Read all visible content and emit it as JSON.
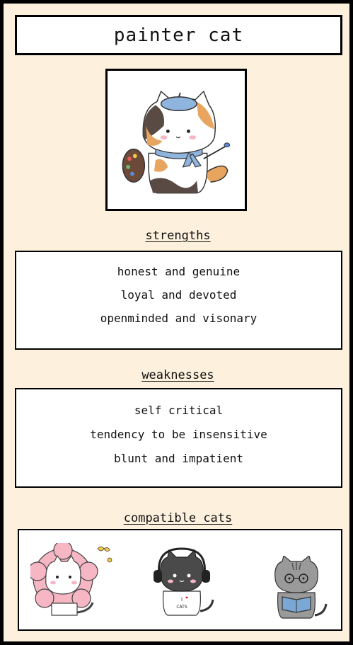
{
  "title": "painter cat",
  "strengths": {
    "heading": "strengths",
    "items": [
      "honest and genuine",
      "loyal and devoted",
      "openminded and visonary"
    ]
  },
  "weaknesses": {
    "heading": "weaknesses",
    "items": [
      "self critical",
      "tendency to be insensitive",
      "blunt and impatient"
    ]
  },
  "compatible": {
    "heading": "compatible cats",
    "cats": [
      "flower-cat",
      "headphones-cat",
      "reading-cat"
    ],
    "shirt_text_top": "I",
    "shirt_text_bottom": "CATS"
  },
  "colors": {
    "background": "#fdf1de",
    "beret": "#8fb4de",
    "scarf": "#8fb4de",
    "orange_patch": "#e8a560",
    "dark_patch": "#5a4a44",
    "flower": "#f6b6c4"
  }
}
